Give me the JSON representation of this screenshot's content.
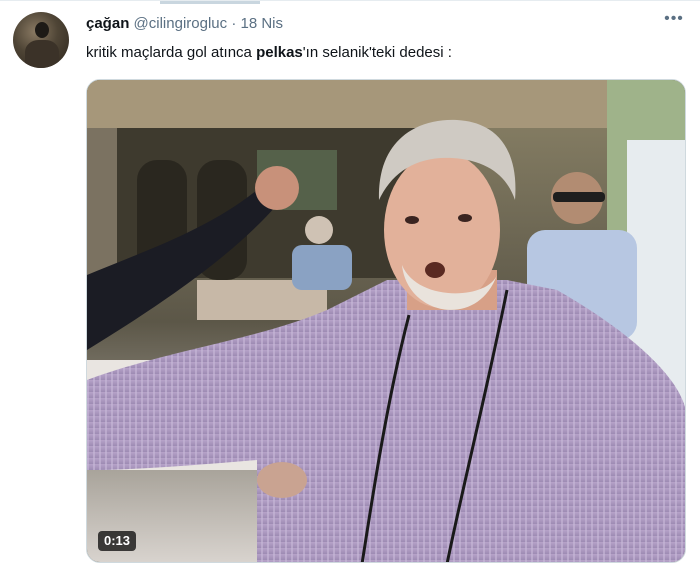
{
  "tweet": {
    "display_name": "çağan",
    "handle": "@cilingirogluc",
    "separator": "·",
    "date": "18 Nis",
    "text_before": "kritik maçlarda gol atınca ",
    "text_bold": "pelkas",
    "text_after": "'ın selanik'teki dedesi :",
    "more_icon": "more-horizontal-icon"
  },
  "media": {
    "type": "video",
    "duration": "0:13"
  },
  "colors": {
    "text_primary": "#0f1419",
    "text_secondary": "#5b7083",
    "border": "#cfd9de"
  }
}
